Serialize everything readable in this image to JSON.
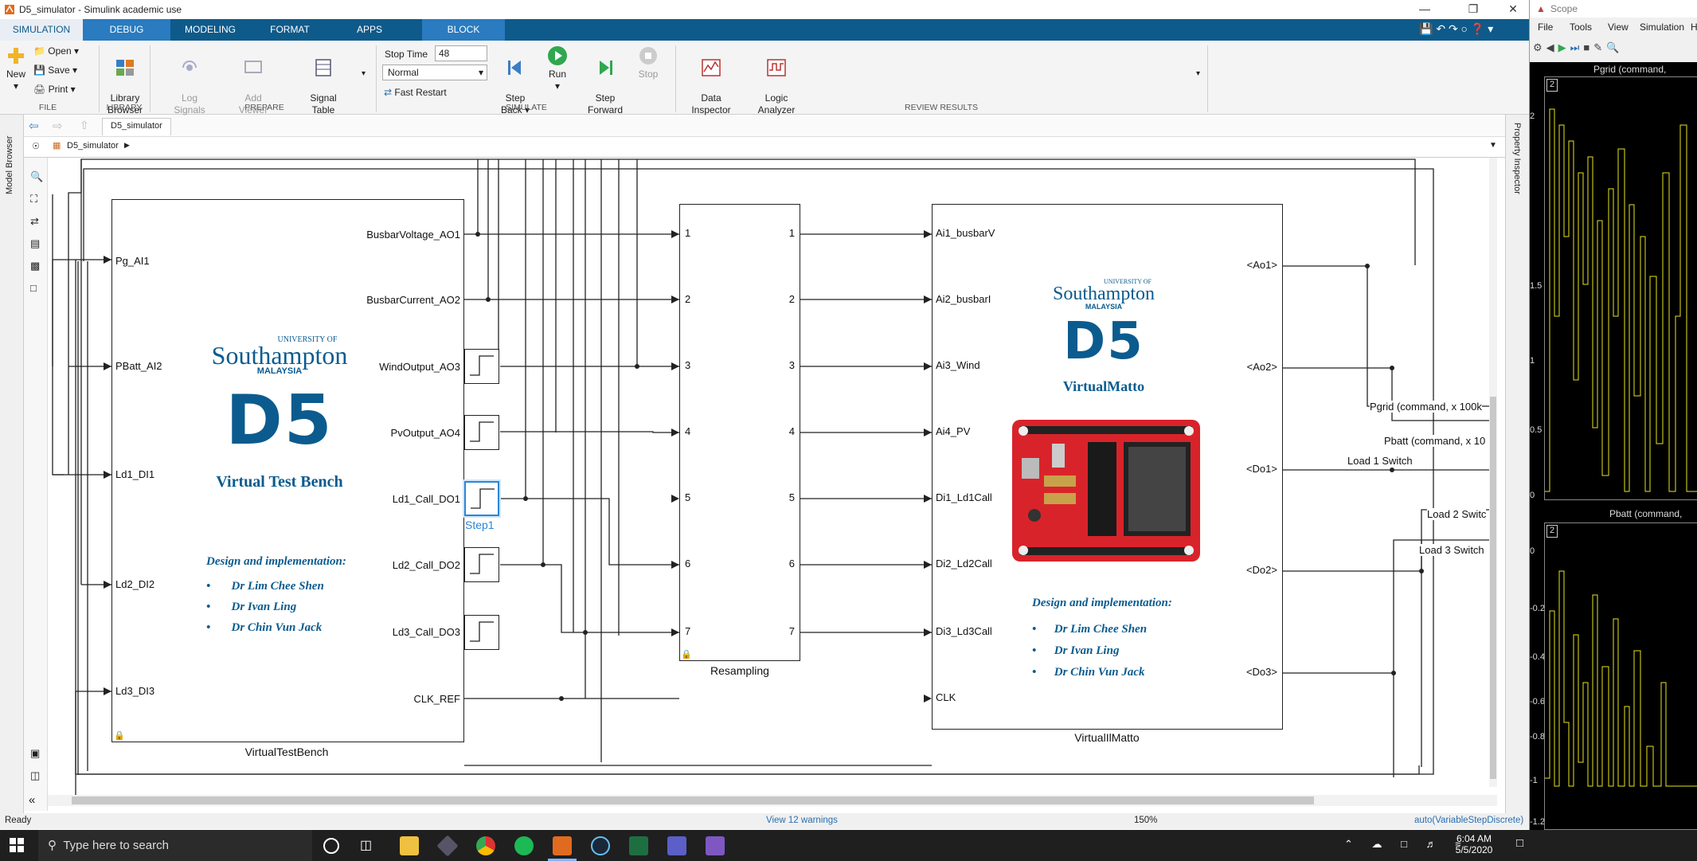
{
  "window": {
    "title": "D5_simulator - Simulink academic use"
  },
  "ribbon_tabs": [
    "SIMULATION",
    "DEBUG",
    "MODELING",
    "FORMAT",
    "APPS",
    "BLOCK"
  ],
  "file_group": {
    "new": "New",
    "open": "Open",
    "save": "Save",
    "print": "Print",
    "label": "FILE"
  },
  "library_group": {
    "library_browser": "Library\nBrowser",
    "label": "LIBRARY"
  },
  "prepare_group": {
    "log_signals": "Log\nSignals",
    "add_viewer": "Add\nViewer",
    "signal_table": "Signal\nTable",
    "label": "PREPARE"
  },
  "simulate_group": {
    "stop_time_label": "Stop Time",
    "stop_time_value": "48",
    "mode_value": "Normal",
    "fast_restart": "Fast Restart",
    "step_back": "Step\nBack",
    "run": "Run",
    "step_forward": "Step\nForward",
    "stop": "Stop",
    "label": "SIMULATE"
  },
  "review_group": {
    "data_inspector": "Data\nInspector",
    "logic_analyzer": "Logic\nAnalyzer",
    "label": "REVIEW RESULTS"
  },
  "model_tab": "D5_simulator",
  "breadcrumb": "D5_simulator",
  "side_panels": {
    "left": "Model Browser",
    "right": "Property Inspector"
  },
  "blocks": {
    "vtb": {
      "name": "VirtualTestBench",
      "inputs": [
        "Pg_AI1",
        "PBatt_AI2",
        "Ld1_DI1",
        "Ld2_DI2",
        "Ld3_DI3"
      ],
      "outputs": [
        "BusbarVoltage_AO1",
        "BusbarCurrent_AO2",
        "WindOutput_AO3",
        "PvOutput_AO4",
        "Ld1_Call_DO1",
        "Ld2_Call_DO2",
        "Ld3_Call_DO3",
        "CLK_REF"
      ],
      "univ_small": "UNIVERSITY OF",
      "univ_big": "Southampton",
      "univ_country": "MALAYSIA",
      "logo_mark": "D5",
      "subtitle": "Virtual Test Bench",
      "credit_title": "Design and implementation:",
      "credits": [
        "Dr Lim Chee Shen",
        "Dr Ivan Ling",
        "Dr Chin Vun Jack"
      ]
    },
    "step_label": "Step1",
    "resampling": {
      "name": "Resampling",
      "ports": [
        "1",
        "2",
        "3",
        "4",
        "5",
        "6",
        "7"
      ]
    },
    "vim": {
      "name": "VirtualIlMatto",
      "inputs": [
        "Ai1_busbarV",
        "Ai2_busbarI",
        "Ai3_Wind",
        "Ai4_PV",
        "Di1_Ld1Call",
        "Di2_Ld2Call",
        "Di3_Ld3Call",
        "CLK"
      ],
      "outputs": [
        "<Ao1>",
        "<Ao2>",
        "<Do1>",
        "<Do2>",
        "<Do3>"
      ],
      "univ_small": "UNIVERSITY OF",
      "univ_big": "Southampton",
      "univ_country": "MALAYSIA",
      "logo_mark": "D5",
      "subtitle": "VirtualMatto",
      "credit_title": "Design and implementation:",
      "credits": [
        "Dr Lim Chee Shen",
        "Dr Ivan Ling",
        "Dr Chin Vun Jack"
      ]
    },
    "signal_labels": [
      "Pgrid (command, x 100k",
      "Pbatt (command, x 10",
      "Load 1 Switch",
      "Load 2 Switc",
      "Load 3 Switch"
    ]
  },
  "status": {
    "left": "Ready",
    "warnings": "View 12 warnings",
    "zoom": "150%",
    "solver": "auto(VariableStepDiscrete)"
  },
  "taskbar": {
    "search_placeholder": "Type here to search",
    "time": "6:04 AM",
    "date": "5/5/2020"
  },
  "scope": {
    "title": "Scope",
    "menu": [
      "File",
      "Tools",
      "View",
      "Simulation",
      "H"
    ],
    "plot1_title": "Pgrid (command,",
    "plot1_yticks": [
      "2",
      "1.5",
      "1",
      "0.5",
      "0"
    ],
    "plot1_badge": "2",
    "plot2_title": "Pbatt (command,",
    "plot2_yticks": [
      "0",
      "-0.2",
      "-0.4",
      "-0.6",
      "-0.8",
      "-1",
      "-1.2"
    ],
    "plot2_badge": "2"
  }
}
